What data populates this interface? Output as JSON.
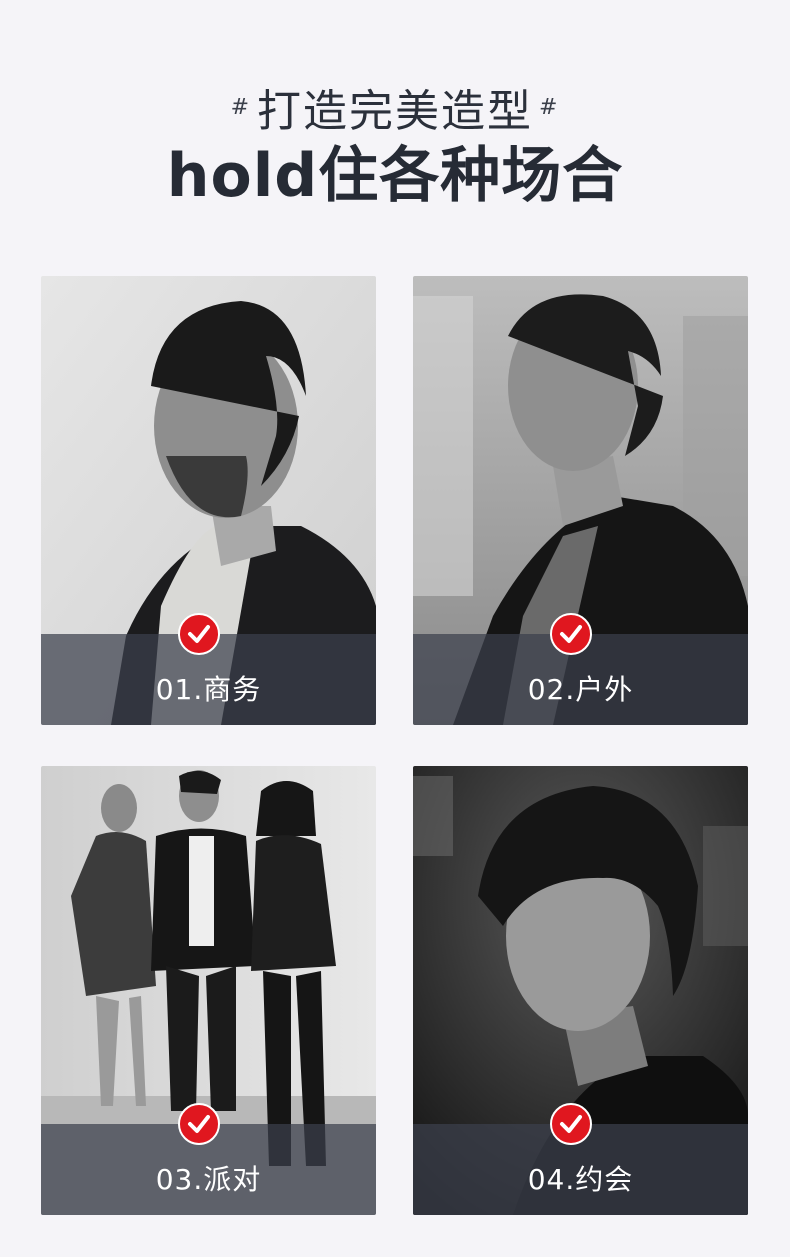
{
  "header": {
    "hash_left": "#",
    "subtitle": "打造完美造型",
    "hash_right": "#",
    "title": "hold住各种场合"
  },
  "cards": [
    {
      "caption": "01.商务",
      "icon": "check-icon"
    },
    {
      "caption": "02.户外",
      "icon": "check-icon"
    },
    {
      "caption": "03.派对",
      "icon": "check-icon"
    },
    {
      "caption": "04.约会",
      "icon": "check-icon"
    }
  ],
  "colors": {
    "background": "#f5f4f8",
    "title_text": "#262b35",
    "check_badge": "#e0171f",
    "caption_band": "#3c404c"
  }
}
